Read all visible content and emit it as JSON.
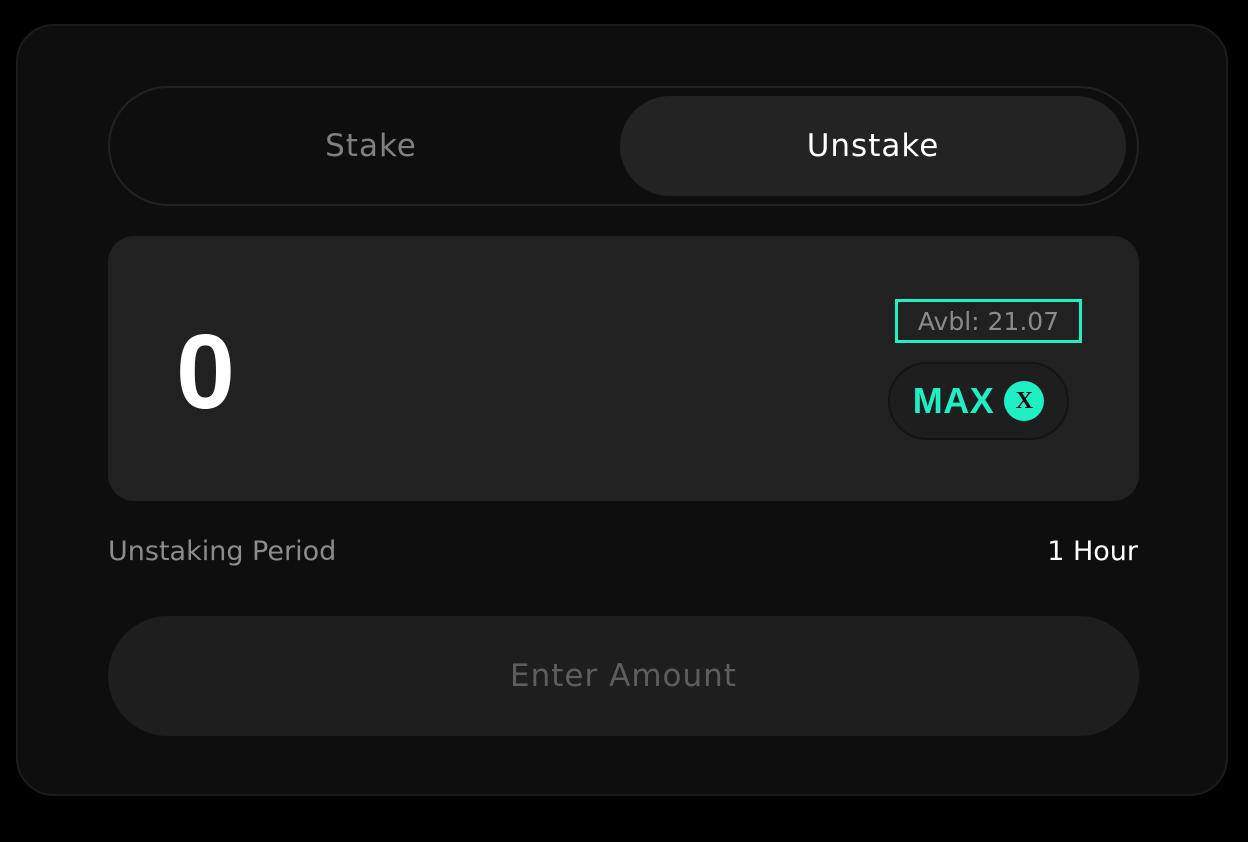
{
  "tabs": {
    "stake_label": "Stake",
    "unstake_label": "Unstake",
    "active": "Unstake"
  },
  "amount": {
    "value": "0",
    "available": "Avbl: 21.07",
    "max_label": "MAX",
    "token_icon_glyph": "X",
    "token_icon_name": "token-x-icon"
  },
  "period": {
    "label": "Unstaking Period",
    "value": "1 Hour"
  },
  "submit": {
    "label": "Enter Amount"
  },
  "colors": {
    "accent": "#1ef0c4",
    "background": "#000000",
    "card": "#0e0e0e",
    "panel": "#212121"
  }
}
